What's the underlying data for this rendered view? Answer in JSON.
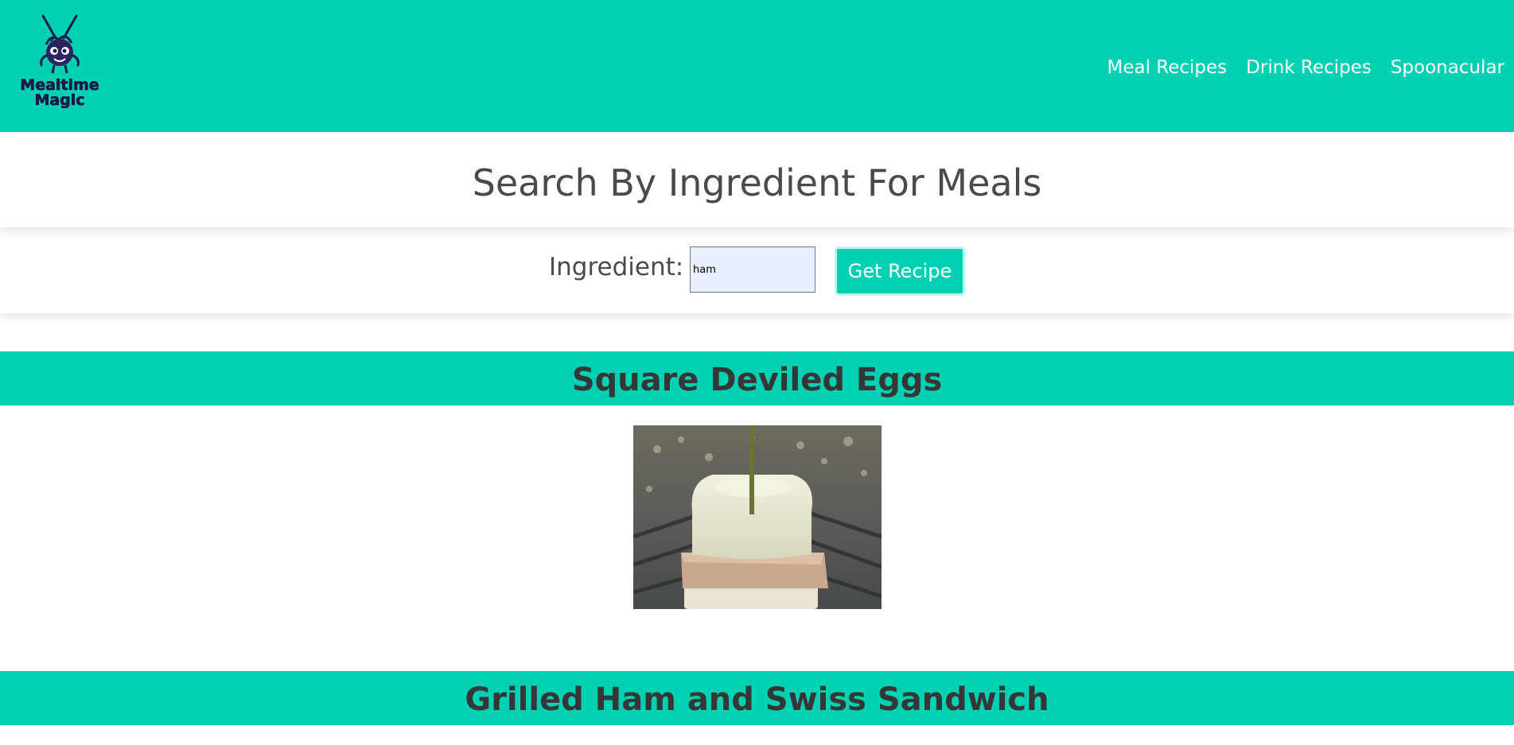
{
  "header": {
    "logo_line1": "Mealtime",
    "logo_line2": "Magic",
    "nav": [
      {
        "label": "Meal Recipes"
      },
      {
        "label": "Drink Recipes"
      },
      {
        "label": "Spoonacular"
      }
    ]
  },
  "page": {
    "title": "Search By Ingredient For Meals"
  },
  "search": {
    "label": "Ingredient:",
    "value": "ham",
    "button_label": "Get Recipe"
  },
  "results": [
    {
      "title": "Square Deviled Eggs",
      "image": "deviled-egg-ham-skewer-photo"
    },
    {
      "title": "Grilled Ham and Swiss Sandwich"
    }
  ],
  "colors": {
    "primary": "#00d1b2",
    "text": "#4a4a4a",
    "title_text": "#363636",
    "logo": "#1f1a4d"
  }
}
